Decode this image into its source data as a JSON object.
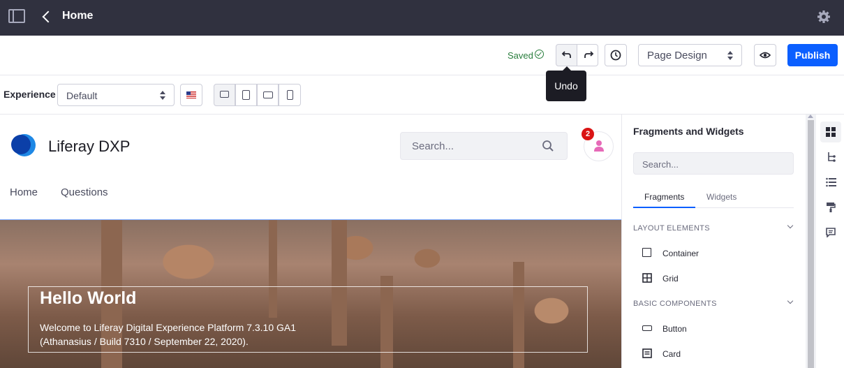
{
  "header": {
    "title": "Home",
    "settings_icon": "gear-icon"
  },
  "toolbar": {
    "saved_label": "Saved",
    "undo_tooltip": "Undo",
    "mode_select": "Page Design",
    "publish_label": "Publish"
  },
  "experience": {
    "label": "Experience",
    "selected": "Default"
  },
  "site": {
    "name": "Liferay DXP",
    "search_placeholder": "Search...",
    "notification_count": "2",
    "nav": [
      "Home",
      "Questions"
    ],
    "hero_title": "Hello World",
    "hero_line1": "Welcome to Liferay Digital Experience Platform 7.3.10 GA1",
    "hero_line2": "(Athanasius / Build 7310 / September 22, 2020)."
  },
  "panel": {
    "title": "Fragments and Widgets",
    "search_placeholder": "Search...",
    "tabs": [
      "Fragments",
      "Widgets"
    ],
    "sections": [
      {
        "name": "LAYOUT ELEMENTS",
        "items": [
          "Container",
          "Grid"
        ]
      },
      {
        "name": "BASIC COMPONENTS",
        "items": [
          "Button",
          "Card"
        ]
      }
    ]
  },
  "colors": {
    "primary": "#0b5fff",
    "topbar": "#30313f",
    "saved": "#287d3c",
    "badge": "#da1414"
  }
}
